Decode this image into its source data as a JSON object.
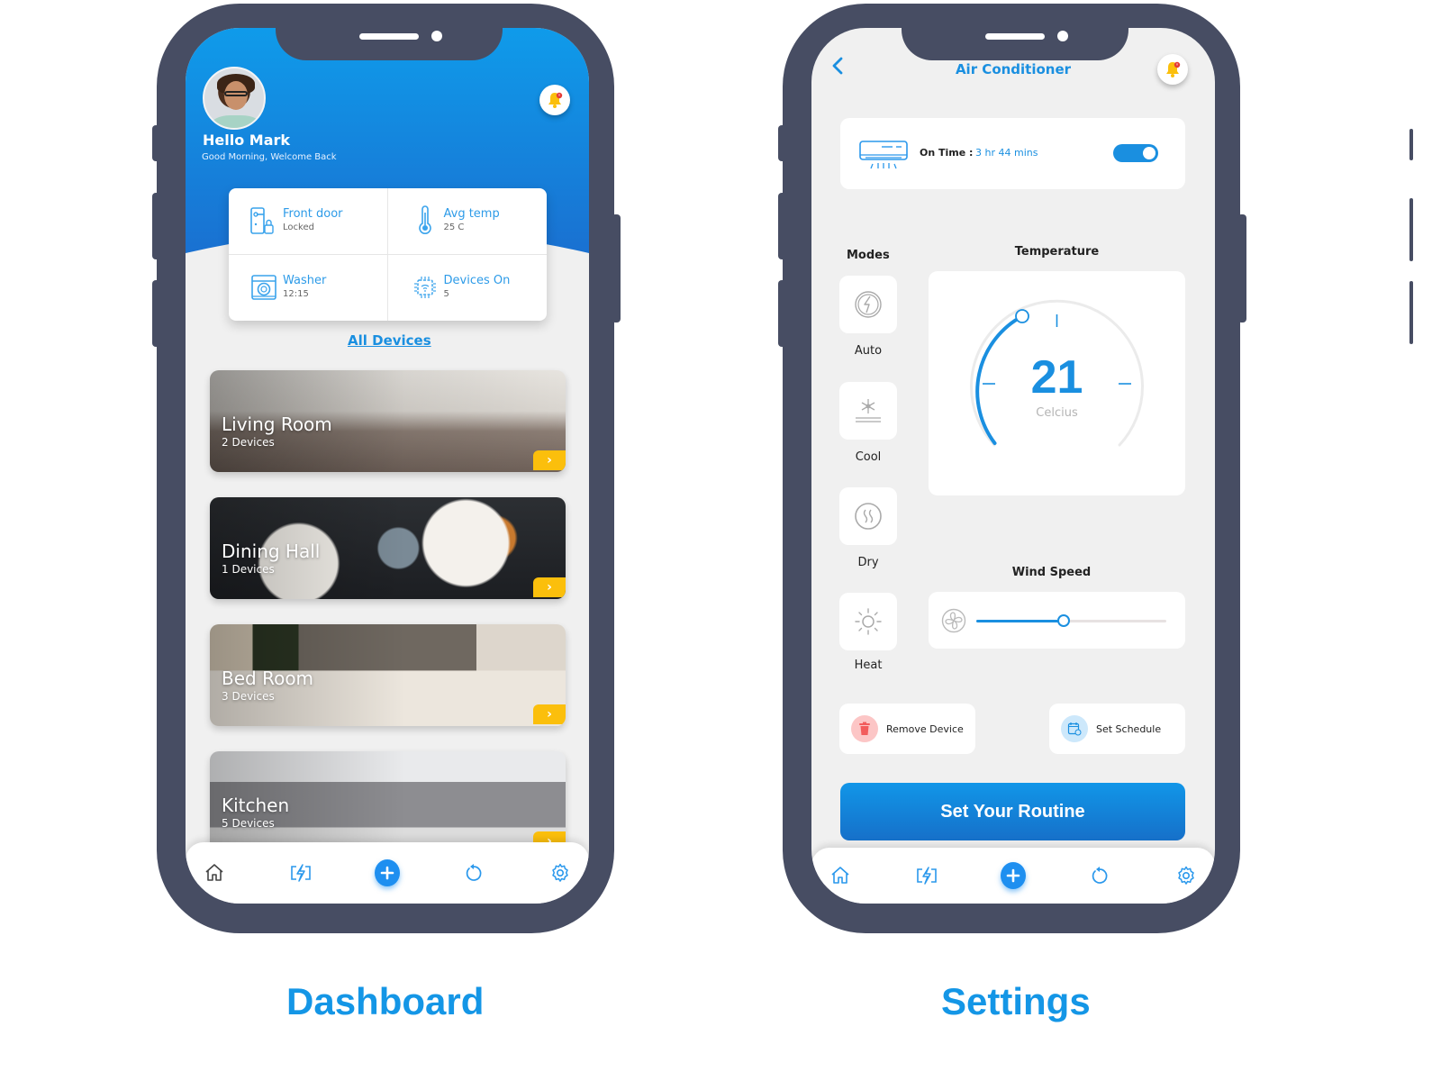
{
  "captions": {
    "dashboard": "Dashboard",
    "settings": "Settings"
  },
  "colors": {
    "accent": "#1a8fe0",
    "frame": "#474d63",
    "arrow": "#fbbf0c",
    "remove": "#f25c5c"
  },
  "dashboard": {
    "greeting_name": "Hello Mark",
    "greeting_sub": "Good Morning, Welcome Back",
    "stats": [
      {
        "icon": "door-lock-icon",
        "title": "Front door",
        "value": "Locked"
      },
      {
        "icon": "thermometer-icon",
        "title": "Avg temp",
        "value": "25 C"
      },
      {
        "icon": "washer-icon",
        "title": "Washer",
        "value": "12:15"
      },
      {
        "icon": "chip-icon",
        "title": "Devices On",
        "value": "5"
      }
    ],
    "all_devices_link": "All Devices",
    "rooms": [
      {
        "name": "Living Room",
        "devices": "2 Devices"
      },
      {
        "name": "Dining Hall",
        "devices": "1 Devices"
      },
      {
        "name": "Bed Room",
        "devices": "3 Devices"
      },
      {
        "name": "Kitchen",
        "devices": "5 Devices"
      }
    ],
    "arrow_glyph": "›"
  },
  "tabbar": {
    "items": [
      "home-icon",
      "energy-icon",
      "add-icon",
      "history-icon",
      "settings-icon"
    ],
    "plus_glyph": "+"
  },
  "settings": {
    "title": "Air Conditioner",
    "on_time_label": "On Time :",
    "on_time_value": "3 hr 44 mins",
    "power_on": true,
    "modes_label": "Modes",
    "modes": [
      "Auto",
      "Cool",
      "Dry",
      "Heat"
    ],
    "temperature_label": "Temperature",
    "temperature_value": "21",
    "temperature_unit": "Celcius",
    "wind_speed_label": "Wind Speed",
    "wind_speed_percent": 46,
    "remove_device": "Remove Device",
    "set_schedule": "Set Schedule",
    "routine_button": "Set Your Routine"
  }
}
